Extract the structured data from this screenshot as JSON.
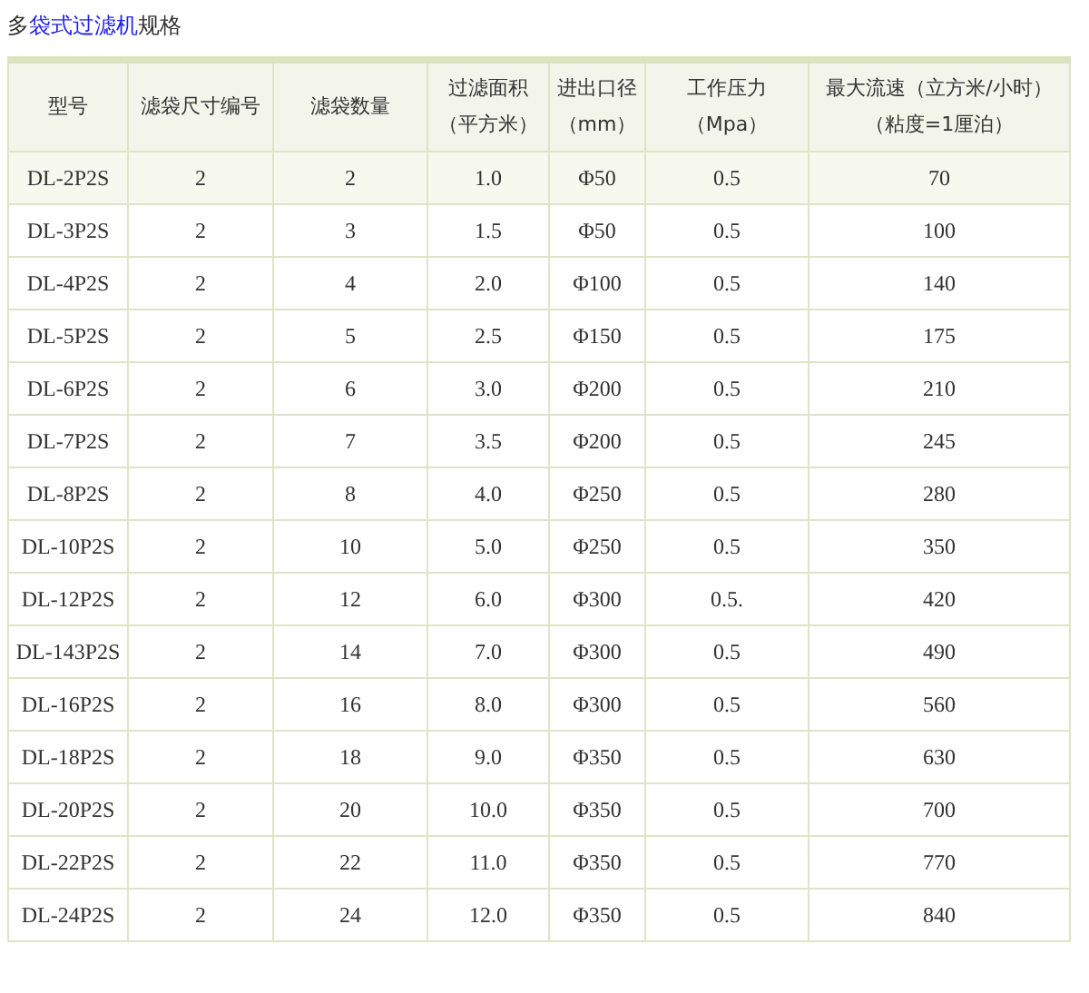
{
  "title": {
    "prefix": "多",
    "link": "袋式过滤机",
    "suffix": "规格"
  },
  "table": {
    "columns": [
      {
        "lines": [
          "型号"
        ]
      },
      {
        "lines": [
          "滤袋尺寸编号"
        ]
      },
      {
        "lines": [
          "滤袋数量"
        ]
      },
      {
        "lines": [
          "过滤面积",
          "（平方米）"
        ]
      },
      {
        "lines": [
          "进出口径",
          "（mm）"
        ]
      },
      {
        "lines": [
          "工作压力",
          "（Mpa）"
        ]
      },
      {
        "lines": [
          "最大流速（立方米/小时）",
          "（粘度=1厘泊）"
        ]
      }
    ],
    "rows": [
      {
        "highlighted": true,
        "cells": [
          "DL-2P2S",
          "2",
          "2",
          "1.0",
          "Φ50",
          "0.5",
          "70"
        ]
      },
      {
        "highlighted": false,
        "cells": [
          "DL-3P2S",
          "2",
          "3",
          "1.5",
          "Φ50",
          "0.5",
          "100"
        ]
      },
      {
        "highlighted": false,
        "cells": [
          "DL-4P2S",
          "2",
          "4",
          "2.0",
          "Φ100",
          "0.5",
          "140"
        ]
      },
      {
        "highlighted": false,
        "cells": [
          "DL-5P2S",
          "2",
          "5",
          "2.5",
          "Φ150",
          "0.5",
          "175"
        ]
      },
      {
        "highlighted": false,
        "cells": [
          "DL-6P2S",
          "2",
          "6",
          "3.0",
          "Φ200",
          "0.5",
          "210"
        ]
      },
      {
        "highlighted": false,
        "cells": [
          "DL-7P2S",
          "2",
          "7",
          "3.5",
          "Φ200",
          "0.5",
          "245"
        ]
      },
      {
        "highlighted": false,
        "cells": [
          "DL-8P2S",
          "2",
          "8",
          "4.0",
          "Φ250",
          "0.5",
          "280"
        ]
      },
      {
        "highlighted": false,
        "cells": [
          "DL-10P2S",
          "2",
          "10",
          "5.0",
          "Φ250",
          "0.5",
          "350"
        ]
      },
      {
        "highlighted": false,
        "cells": [
          "DL-12P2S",
          "2",
          "12",
          "6.0",
          "Φ300",
          "0.5.",
          "420"
        ]
      },
      {
        "highlighted": false,
        "cells": [
          "DL-143P2S",
          "2",
          "14",
          "7.0",
          "Φ300",
          "0.5",
          "490"
        ]
      },
      {
        "highlighted": false,
        "cells": [
          "DL-16P2S",
          "2",
          "16",
          "8.0",
          "Φ300",
          "0.5",
          "560"
        ]
      },
      {
        "highlighted": false,
        "cells": [
          "DL-18P2S",
          "2",
          "18",
          "9.0",
          "Φ350",
          "0.5",
          "630"
        ]
      },
      {
        "highlighted": false,
        "cells": [
          "DL-20P2S",
          "2",
          "20",
          "10.0",
          "Φ350",
          "0.5",
          "700"
        ]
      },
      {
        "highlighted": false,
        "cells": [
          "DL-22P2S",
          "2",
          "22",
          "11.0",
          "Φ350",
          "0.5",
          "770"
        ]
      },
      {
        "highlighted": false,
        "cells": [
          "DL-24P2S",
          "2",
          "24",
          "12.0",
          "Φ350",
          "0.5",
          "840"
        ]
      }
    ]
  }
}
